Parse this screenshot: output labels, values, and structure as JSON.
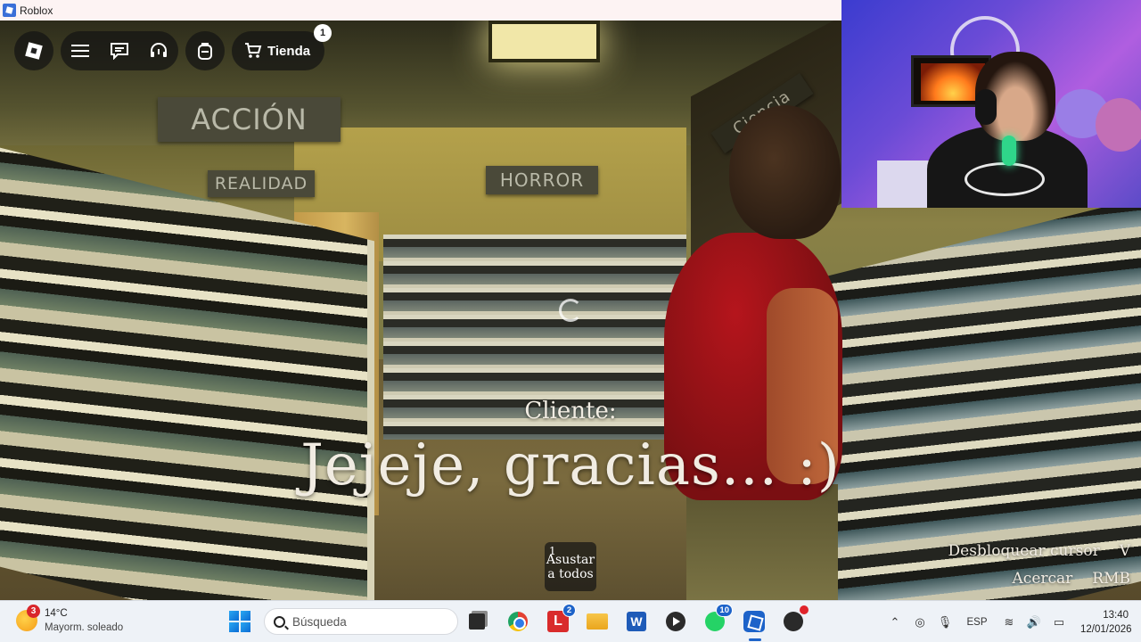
{
  "window": {
    "title": "Roblox"
  },
  "topbar": {
    "shop_label": "Tienda",
    "shop_badge": "1"
  },
  "scene": {
    "signs": {
      "accion": "ACCIÓN",
      "realidad": "REALIDAD",
      "horror": "HORROR",
      "ciencia": "Ciencia ficción"
    }
  },
  "dialog": {
    "speaker": "Cliente:",
    "line": "Jejeje, gracias... :)"
  },
  "action": {
    "key": "1",
    "label": "Asustar a todos"
  },
  "hints": [
    {
      "label": "Desbloquear cursor",
      "key": "V"
    },
    {
      "label": "Acercar",
      "key": "RMB"
    }
  ],
  "taskbar": {
    "weather": {
      "badge": "3",
      "temp": "14°C",
      "desc": "Mayorm. soleado"
    },
    "search": {
      "placeholder": "Búsqueda"
    },
    "apps": {
      "l_badge": "2",
      "whatsapp_badge": "10"
    },
    "tray": {
      "language": "ESP",
      "time": "13:40",
      "date": "12/01/2026"
    }
  },
  "colors": {
    "accent": "#1d63c9",
    "npc_shirt": "#b5151c",
    "dialog_text": "#f1ece2"
  }
}
